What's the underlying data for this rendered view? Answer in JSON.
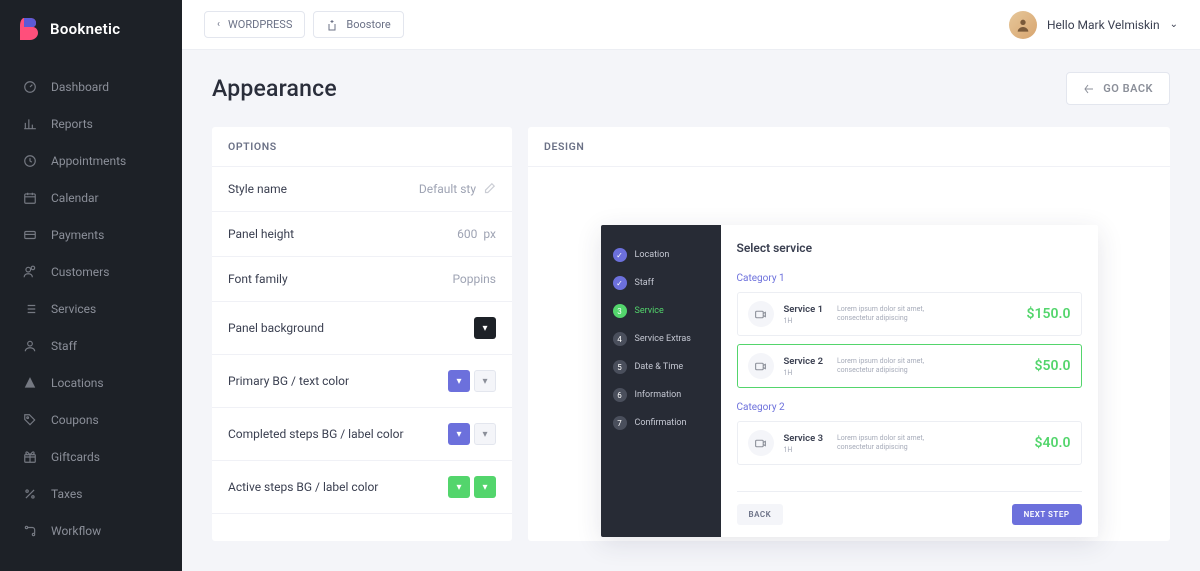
{
  "brand": "Booknetic",
  "nav": [
    "Dashboard",
    "Reports",
    "Appointments",
    "Calendar",
    "Payments",
    "Customers",
    "Services",
    "Staff",
    "Locations",
    "Coupons",
    "Giftcards",
    "Taxes",
    "Workflow"
  ],
  "breadcrumbs": {
    "root": "WORDPRESS",
    "current": "Boostore"
  },
  "user": {
    "greeting": "Hello Mark Velmiskin"
  },
  "page": {
    "title": "Appearance",
    "back": "GO BACK"
  },
  "optionsHeader": "OPTIONS",
  "designHeader": "DESIGN",
  "options": {
    "styleName": {
      "label": "Style name",
      "value": "Default sty"
    },
    "panelHeight": {
      "label": "Panel height",
      "value": "600",
      "unit": "px"
    },
    "fontFamily": {
      "label": "Font family",
      "value": "Poppins"
    },
    "panelBg": {
      "label": "Panel background"
    },
    "primaryBg": {
      "label": "Primary BG / text color"
    },
    "completedBg": {
      "label": "Completed steps BG / label color"
    },
    "activeBg": {
      "label": "Active steps BG / label color"
    }
  },
  "preview": {
    "title": "Select service",
    "steps": [
      "Location",
      "Staff",
      "Service",
      "Service Extras",
      "Date & Time",
      "Information",
      "Confirmation"
    ],
    "categories": [
      {
        "name": "Category 1",
        "services": [
          {
            "name": "Service 1",
            "sub": "1H",
            "desc": "Lorem ipsum dolor sit amet, consectetur adipiscing",
            "price": "$150.0",
            "selected": false
          },
          {
            "name": "Service 2",
            "sub": "1H",
            "desc": "Lorem ipsum dolor sit amet, consectetur adipiscing",
            "price": "$50.0",
            "selected": true
          }
        ]
      },
      {
        "name": "Category 2",
        "services": [
          {
            "name": "Service 3",
            "sub": "1H",
            "desc": "Lorem ipsum dolor sit amet, consectetur adipiscing",
            "price": "$40.0",
            "selected": false
          }
        ]
      }
    ],
    "back": "BACK",
    "next": "NEXT STEP"
  }
}
